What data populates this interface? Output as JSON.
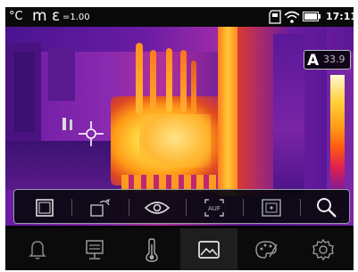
{
  "status_bar": {
    "unit": "°C",
    "distance_unit": "m",
    "emissivity_symbol": "ε",
    "emissivity_value": "=1.00",
    "time": "17:11",
    "icons": [
      "sd-card-icon",
      "wifi-icon",
      "battery-icon"
    ]
  },
  "measurement": {
    "mode": "A",
    "value": "33.9"
  },
  "toolbar": {
    "buttons": [
      "area-select-icon",
      "camera-rotate-icon",
      "eye-icon",
      "autofocus-icon",
      "image-fusion-icon",
      "search-icon"
    ],
    "autofocus_label": "AUF"
  },
  "bottom_nav": {
    "items": [
      "bell-icon",
      "monitor-icon",
      "thermometer-icon",
      "gallery-icon",
      "palette-icon",
      "settings-icon"
    ],
    "active": "gallery-icon"
  },
  "colors": {
    "background": "#000000",
    "toolbar_border": "#9a9aa8",
    "hot": "#ffd23a",
    "cold": "#5a1898"
  }
}
